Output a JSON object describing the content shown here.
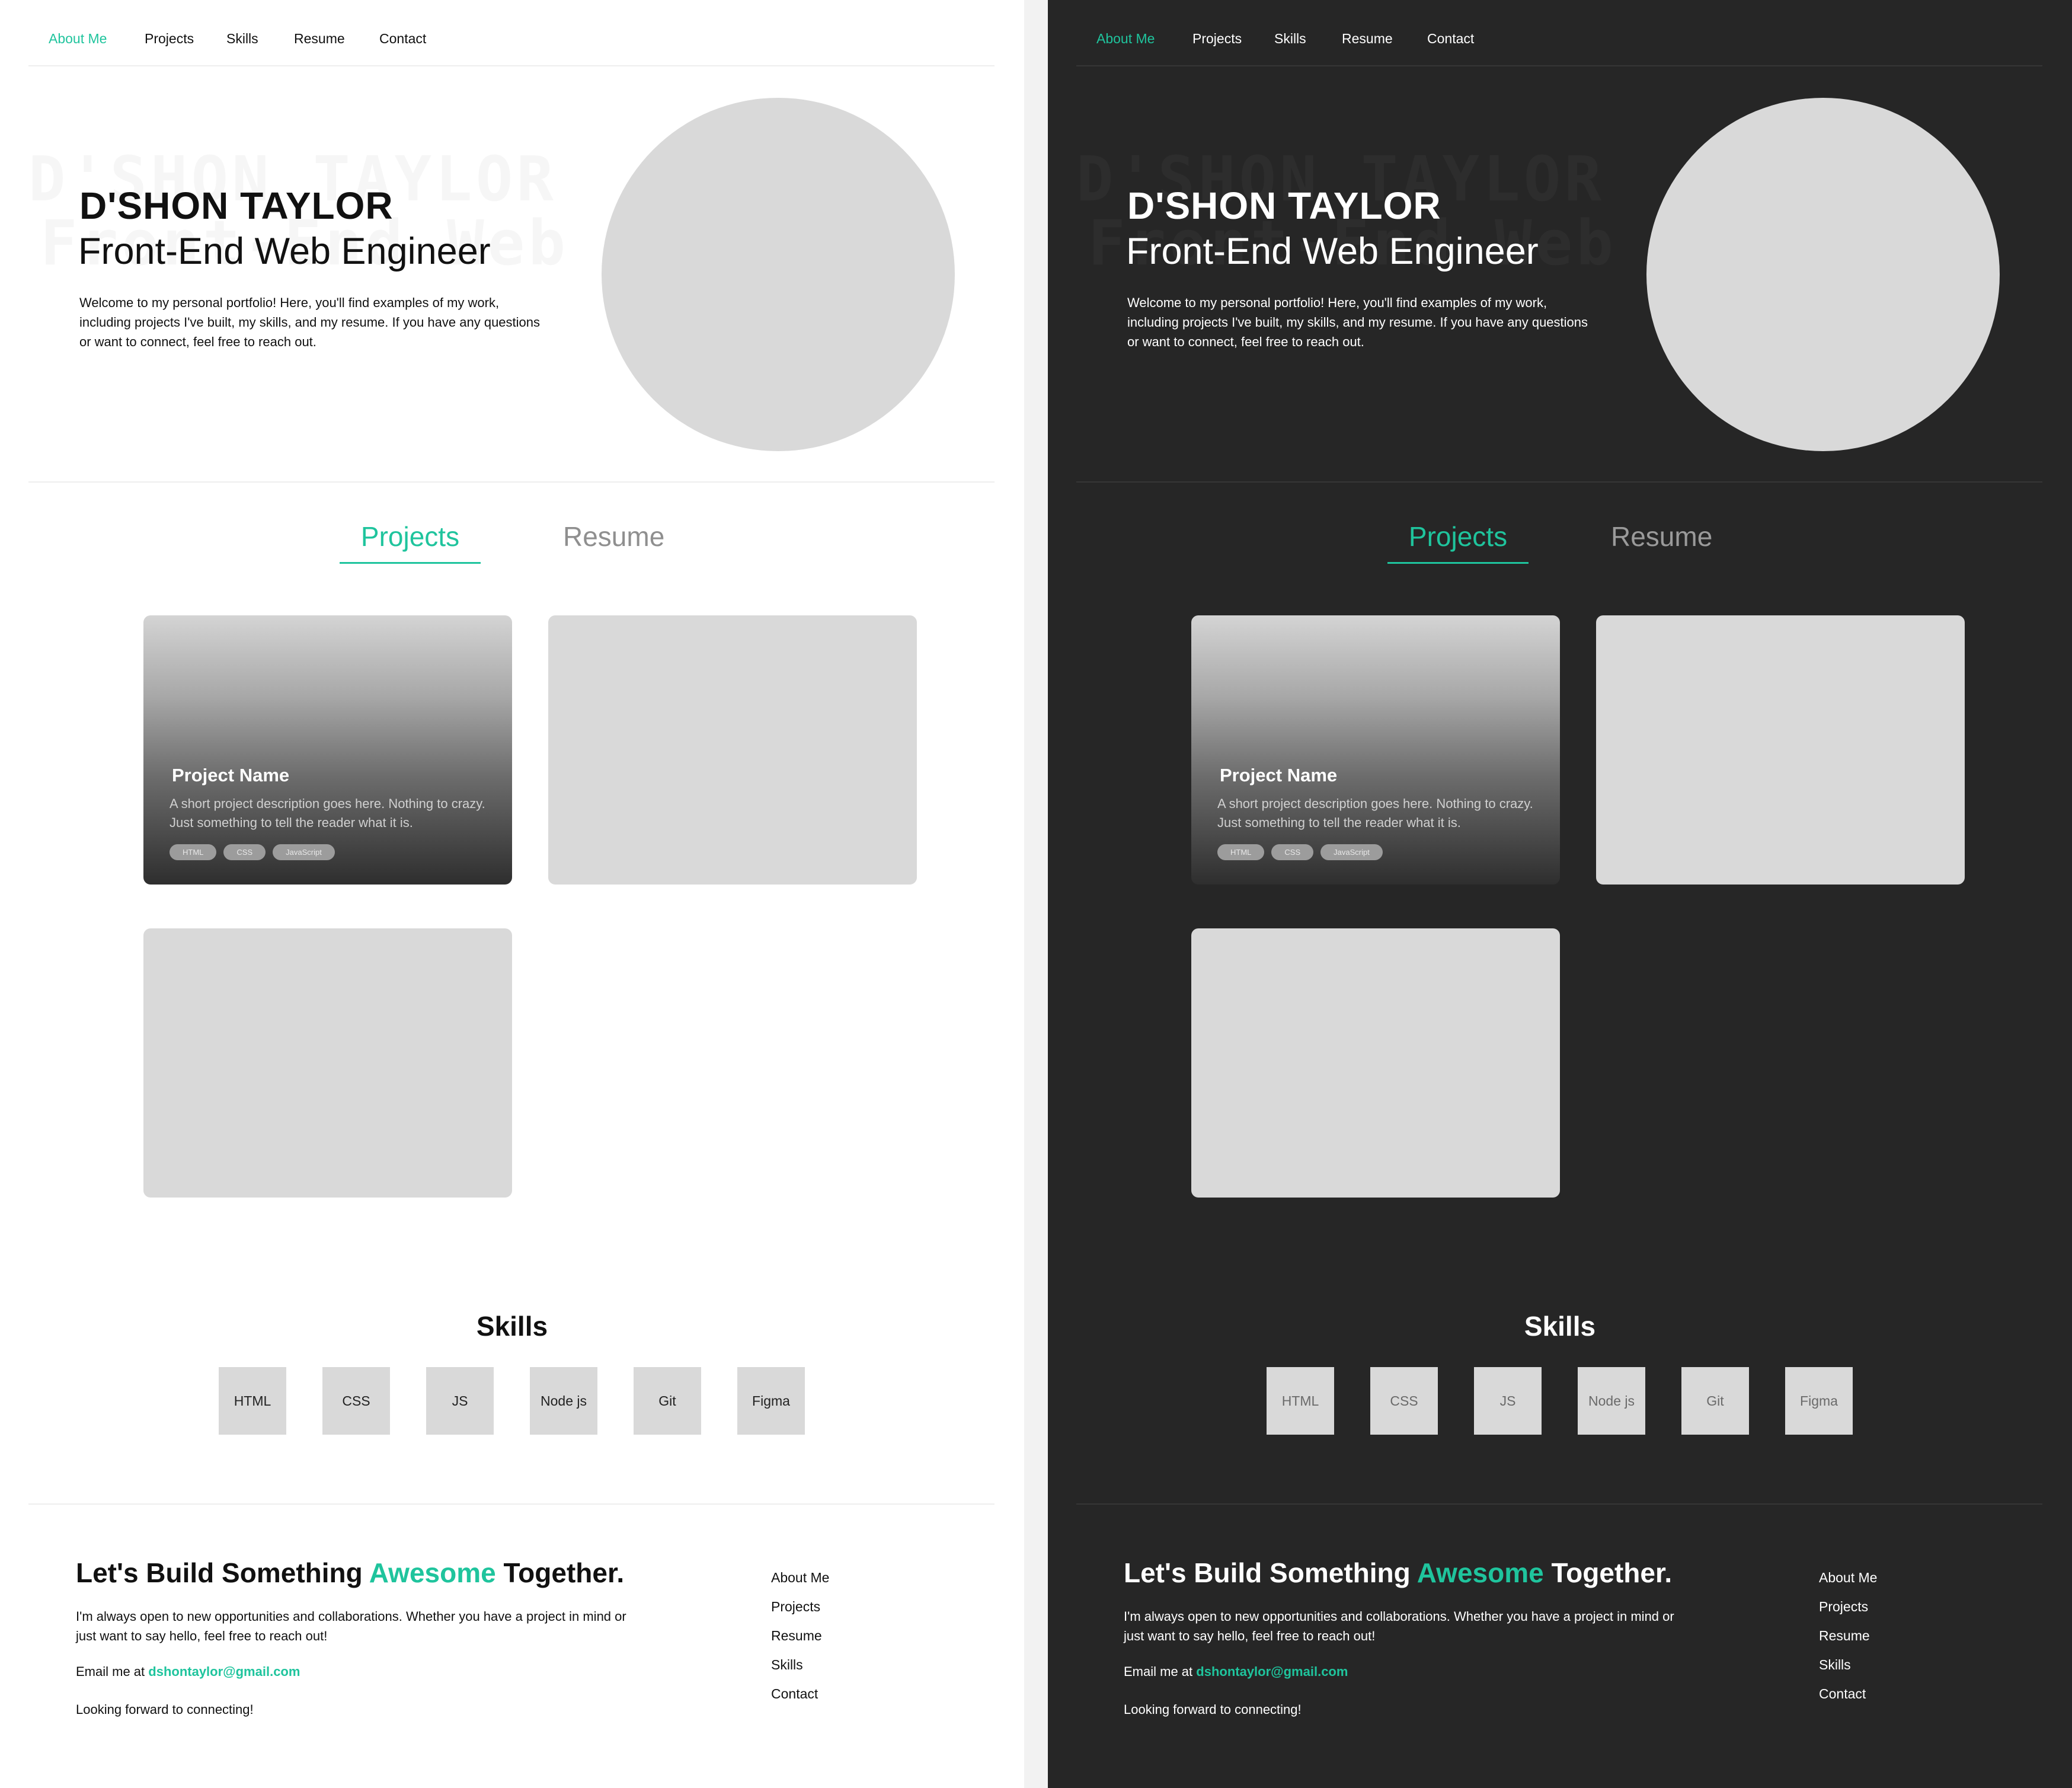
{
  "nav": {
    "items": [
      "About Me",
      "Projects",
      "Skills",
      "Resume",
      "Contact"
    ]
  },
  "hero": {
    "bg_line1": "D'SHON TAYLOR",
    "bg_line2": "Front-End Web Dev",
    "name": "D'SHON TAYLOR",
    "role": "Front-End Web Engineer",
    "intro": "Welcome to my personal portfolio! Here, you'll find examples of my work, including projects I've built, my skills, and my resume. If you have any questions or want to connect, feel free to reach out."
  },
  "tabs": {
    "projects": "Projects",
    "resume": "Resume"
  },
  "project": {
    "name": "Project Name",
    "description": "A short project description goes here. Nothing to crazy. Just something to tell the reader what it is.",
    "tags": [
      "HTML",
      "CSS",
      "JavaScript"
    ]
  },
  "skills": {
    "title": "Skills",
    "items": [
      "HTML",
      "CSS",
      "JS",
      "Node js",
      "Git",
      "Figma"
    ]
  },
  "cta": {
    "title_before": "Let's Build Something ",
    "title_accent": "Awesome",
    "title_after": " Together.",
    "text": "I'm always open to new opportunities and collaborations. Whether you have a project in mind or just want to say hello, feel free to reach out!",
    "email_prefix": "Email me at ",
    "email": "dshontaylor@gmail.com",
    "signoff": "Looking forward to connecting!"
  },
  "footer": {
    "links": [
      "About Me",
      "Projects",
      "Resume",
      "Skills",
      "Contact"
    ]
  },
  "colors": {
    "accent": "#1fc49d",
    "light_bg": "#ffffff",
    "dark_bg": "#262626",
    "placeholder": "#d9d9d9"
  }
}
